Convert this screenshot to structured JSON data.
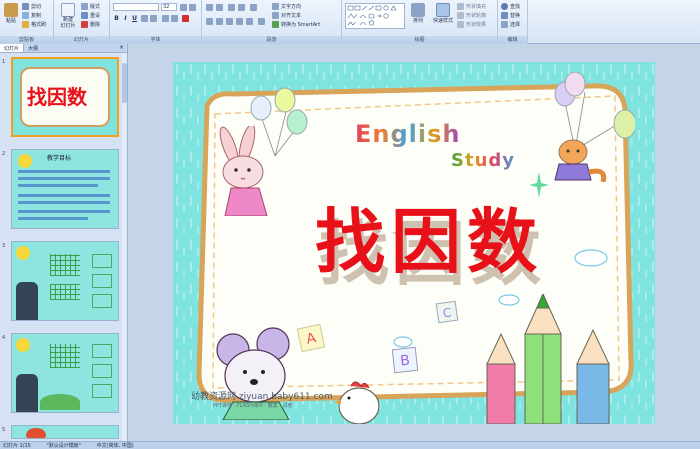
{
  "ribbon": {
    "clipboard": {
      "label": "剪贴板",
      "paste": "粘贴",
      "cut": "剪切",
      "copy": "复制",
      "format_painter": "格式刷"
    },
    "slides": {
      "label": "幻灯片",
      "new_slide": "新建\n幻灯片",
      "layout": "版式",
      "reset": "重设",
      "delete": "删除"
    },
    "font": {
      "label": "字体",
      "font_size": "32"
    },
    "paragraph": {
      "label": "段落",
      "text_direction": "文字方向",
      "align_text": "对齐文本",
      "smartart": "转换为 SmartArt"
    },
    "drawing": {
      "label": "绘图",
      "arrange": "排列",
      "quick_styles": "快速样式",
      "shape_fill": "形状填充",
      "shape_outline": "形状轮廓",
      "shape_effects": "形状效果"
    },
    "editing": {
      "label": "编辑",
      "find": "查找",
      "replace": "替换",
      "select": "选择"
    }
  },
  "panel": {
    "tab_slides": "幻灯片",
    "tab_outline": "大纲",
    "close": "×",
    "thumbs": [
      {
        "num": "1",
        "title": "找因数"
      },
      {
        "num": "2",
        "title": "教学目标"
      },
      {
        "num": "3",
        "title": ""
      },
      {
        "num": "4",
        "title": ""
      },
      {
        "num": "5",
        "title": ""
      }
    ]
  },
  "slide": {
    "english": "English",
    "study": "Study",
    "title": "找因数",
    "block_a": "A",
    "block_b": "B",
    "block_c": "C",
    "footer_site": "幼教资源网 ziyuan.baby611.com",
    "footer_small": "PPT课件 · FLASH课件 · 教案 · 试卷"
  },
  "status": {
    "slide_count": "幻灯片 1/15",
    "theme": "\"默认设计模板\"",
    "language": "中文(简体, 中国)"
  },
  "colors": {
    "title_red": "#e8111a",
    "slide_bg": "#7fe3df",
    "ribbon_bg": "#dce8f7"
  }
}
